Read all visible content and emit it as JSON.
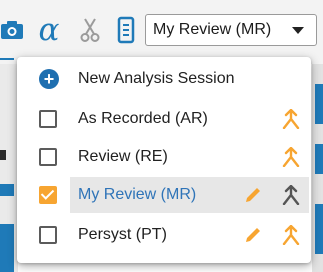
{
  "toolbar": {
    "icons": [
      "camera-icon",
      "alpha-icon",
      "scissors-icon",
      "notes-icon"
    ],
    "alpha_glyph": "α",
    "review_select": {
      "value": "My Review (MR)"
    }
  },
  "menu": {
    "new_session_label": "New Analysis Session",
    "items": [
      {
        "label": "As Recorded (AR)",
        "checked": false,
        "editable": false,
        "merge_color": "#f7a531"
      },
      {
        "label": "Review (RE)",
        "checked": false,
        "editable": false,
        "merge_color": "#f7a531"
      },
      {
        "label": "My Review (MR)",
        "checked": true,
        "editable": true,
        "merge_color": "#555555",
        "highlighted": true
      },
      {
        "label": "Persyst (PT)",
        "checked": false,
        "editable": true,
        "merge_color": "#f7a531"
      }
    ]
  },
  "colors": {
    "accent_blue": "#1f7ab8",
    "accent_orange": "#f7a531",
    "highlight_text": "#2f74b8"
  }
}
